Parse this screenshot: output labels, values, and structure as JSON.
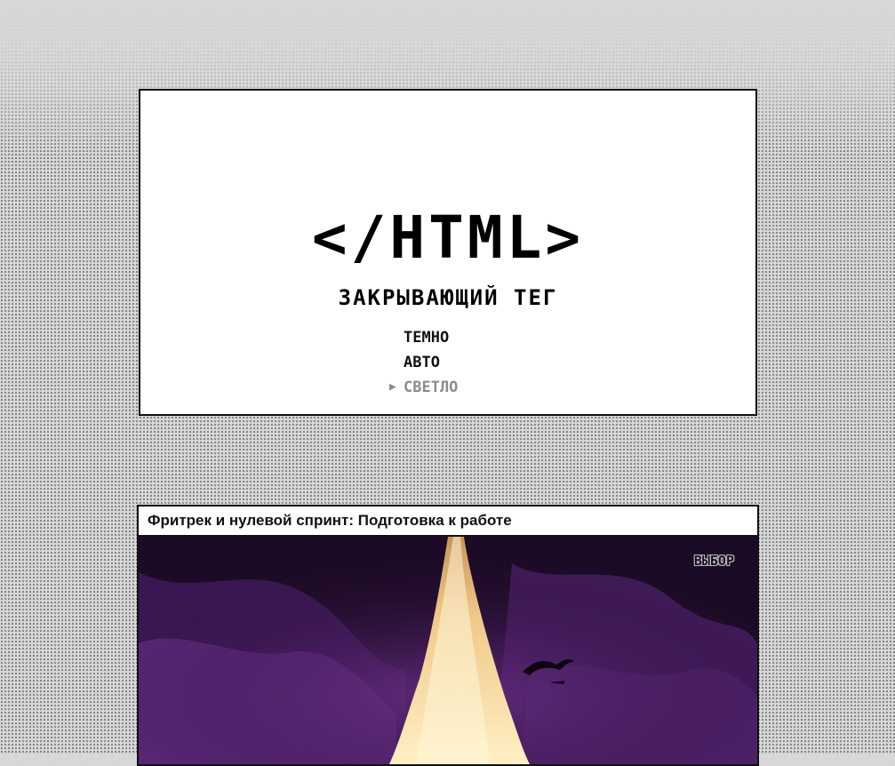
{
  "hero": {
    "logo": "</HTML>",
    "subtitle": "ЗАКРЫВАЮЩИЙ ТЕГ",
    "theme_options": [
      {
        "label": "ТЕМНО",
        "selected": false
      },
      {
        "label": "АВТО",
        "selected": false
      },
      {
        "label": "СВЕТЛО",
        "selected": true
      }
    ],
    "pointer_icon": "triangle-right-icon"
  },
  "article": {
    "title": "Фритрек и нулевой спринт: Подготовка к работе",
    "badge": "ВЫБОР"
  },
  "colors": {
    "page_background": "#d6d6d6",
    "card_background": "#ffffff",
    "text": "#111111",
    "selected_option": "#8c8c8c",
    "art_dark_purple": "#1a0a23",
    "art_purple": "#4a1f66",
    "art_glow": "#f7d58a"
  }
}
